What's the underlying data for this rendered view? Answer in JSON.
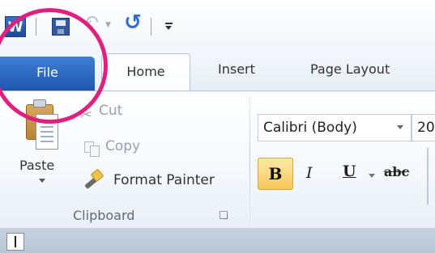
{
  "quick_access": {
    "app_icon_letter": "W"
  },
  "tabs": [
    {
      "label": "File"
    },
    {
      "label": "Home"
    },
    {
      "label": "Insert"
    },
    {
      "label": "Page Layout"
    }
  ],
  "clipboard_group": {
    "paste_label": "Paste",
    "cut_label": "Cut",
    "copy_label": "Copy",
    "format_painter_label": "Format Painter",
    "group_label": "Clipboard"
  },
  "font_group": {
    "font_name": "Calibri (Body)",
    "font_size": "20",
    "bold_label": "B",
    "italic_label": "I",
    "underline_label": "U",
    "strikethrough_label": "abc"
  },
  "annotation": {
    "highlight_color": "#e0207f",
    "highlighted_element": "File tab"
  },
  "colors": {
    "file_tab": "#2a63bf",
    "bold_active": "#f7c85a"
  }
}
